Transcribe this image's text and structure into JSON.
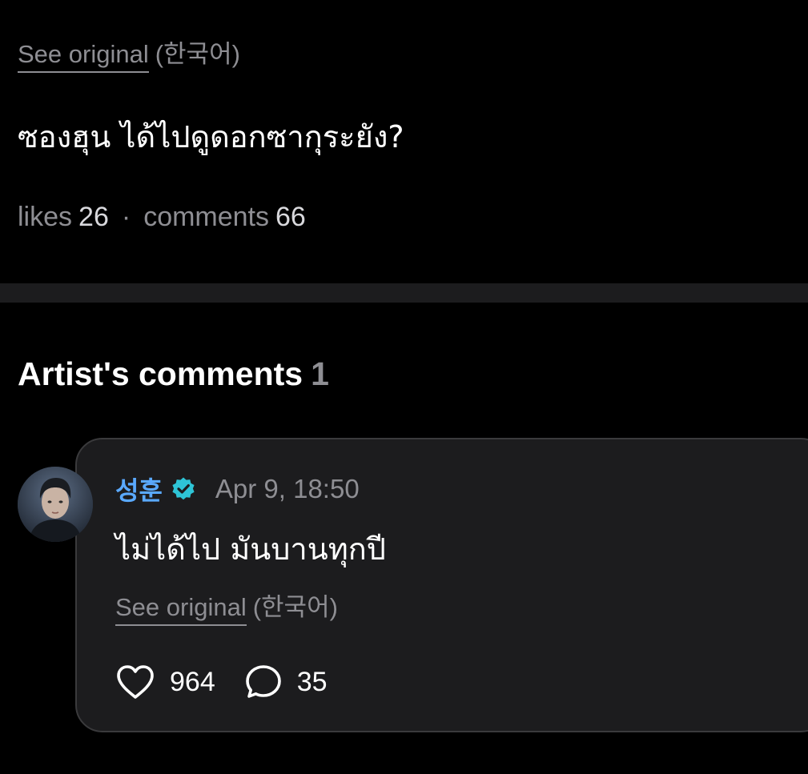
{
  "post": {
    "see_original_label": "See original",
    "see_original_lang": "(한국어)",
    "text": "ซองฮุน ได้ไปดูดอกซากุระยัง?",
    "likes_label": "likes",
    "likes_count": "26",
    "separator": "·",
    "comments_label": "comments",
    "comments_count": "66"
  },
  "artist_comments": {
    "title": "Artist's comments",
    "count": "1",
    "items": [
      {
        "author": "성훈",
        "verified_icon": "verified-badge-icon",
        "time": "Apr 9, 18:50",
        "text": "ไม่ได้ไป มันบานทุกปี",
        "see_original_label": "See original",
        "see_original_lang": "(한국어)",
        "likes": "964",
        "replies": "35"
      }
    ]
  },
  "colors": {
    "background": "#000000",
    "card": "#1c1c1e",
    "muted_text": "#8e8e93",
    "author_blue": "#5aa9ff",
    "verified_teal": "#2ec4d6"
  }
}
